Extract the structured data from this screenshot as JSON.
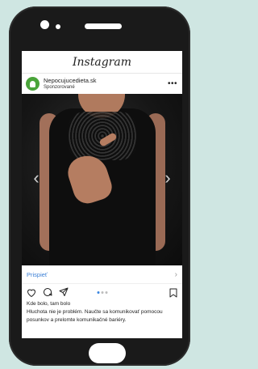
{
  "app": {
    "name": "Instagram"
  },
  "post": {
    "account": "Nepocujucedieta.sk",
    "sponsored_label": "Sponzorované",
    "cta_label": "Prispieť",
    "likes_text": "Kde bolo, tam bolo",
    "caption": "Hluchota nie je problém. Naučte sa komunikovať pomocou posunkov a prelomte komunikačné bariéry.",
    "carousel": {
      "current": 1,
      "total": 3
    }
  },
  "icons": {
    "more": "more-icon",
    "like": "heart-icon",
    "comment": "comment-icon",
    "share": "send-icon",
    "save": "bookmark-icon",
    "prev": "chevron-left-icon",
    "next": "chevron-right-icon"
  },
  "colors": {
    "link": "#3b7fd6",
    "active_dot": "#3b86e0",
    "avatar": "#4aa43a"
  }
}
